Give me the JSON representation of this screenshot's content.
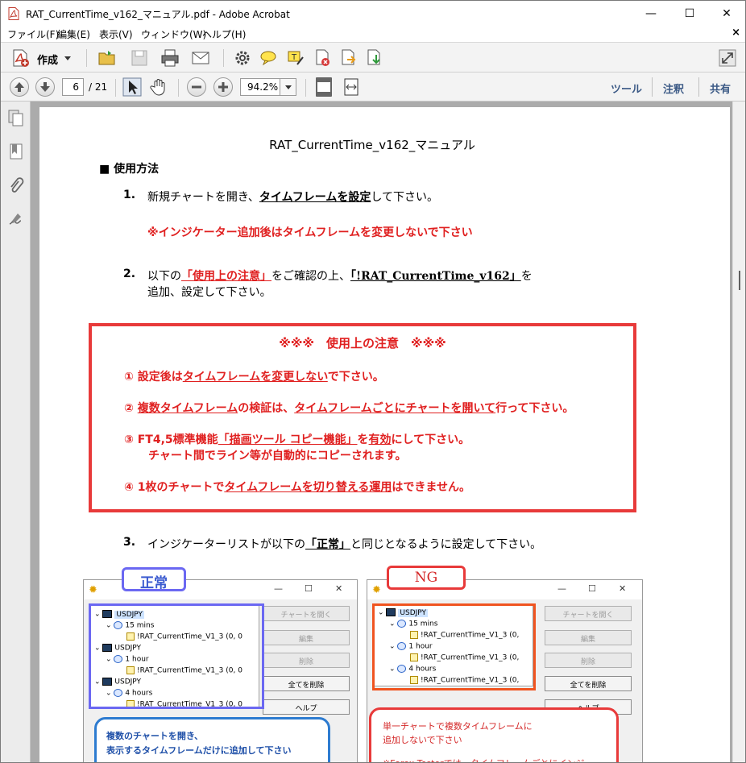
{
  "window": {
    "title": "RAT_CurrentTime_v162_マニュアル.pdf - Adobe Acrobat",
    "minimize": "—",
    "maximize": "☐",
    "close": "✕"
  },
  "menu": {
    "items": [
      "ファイル(F)",
      "編集(E)",
      "表示(V)",
      "ウィンドウ(W)",
      "ヘルプ(H)"
    ],
    "close": "×"
  },
  "toolbar": {
    "create_label": "作成"
  },
  "nav": {
    "page_current": "6",
    "page_total": "/ 21",
    "zoom": "94.2%",
    "tools": "ツール",
    "comment": "注釈",
    "share": "共有"
  },
  "doc": {
    "title": "RAT_CurrentTime_v162_マニュアル",
    "section": "■ 使用方法",
    "step1_num": "1.",
    "step1_a": "新規チャートを開き、",
    "step1_b": "タイムフレームを設定",
    "step1_c": "して下さい。",
    "step1_note": "※インジケーター追加後はタイムフレームを変更しないで下さい",
    "step2_num": "2.",
    "step2_a": "以下の",
    "step2_b": "「使用上の注意」",
    "step2_c": "をご確認の上、",
    "step2_d": "「!RAT_CurrentTime_v162」",
    "step2_e": "を",
    "step2_line2": "追加、設定して下さい。",
    "notice_title": "※※※　使用上の注意　※※※",
    "n1_a": "① 設定後は",
    "n1_b": "タイムフレームを変更しない",
    "n1_c": "で下さい。",
    "n2_a": "② ",
    "n2_b": "複数タイムフレーム",
    "n2_c": "の検証は、",
    "n2_d": "タイムフレームごとにチャートを開いて",
    "n2_e": "行って下さい。",
    "n3_a": "③ FT4,5標準機能",
    "n3_b": "「描画ツール コピー機能」",
    "n3_c": "を",
    "n3_d": "有効",
    "n3_e": "にして下さい。",
    "n3_line2": "チャート間でライン等が自動的にコピーされます。",
    "n4_a": "④ 1枚のチャートで",
    "n4_b": "タイムフレームを切り替える運用",
    "n4_c": "はできません。",
    "step3_num": "3.",
    "step3_a": "インジケーターリストが以下の",
    "step3_b": "「正常」",
    "step3_c": "と同じとなるように設定して下さい。"
  },
  "shot_ok": {
    "label": "正常",
    "rows": [
      {
        "sym": "chart",
        "text": "USDJPY",
        "hl": true
      },
      {
        "sym": "clock",
        "text": "15 mins"
      },
      {
        "sym": "ind",
        "text": "!RAT_CurrentTime_V1_3 (0, 0"
      },
      {
        "sym": "chart",
        "text": "USDJPY"
      },
      {
        "sym": "clock",
        "text": "1 hour"
      },
      {
        "sym": "ind",
        "text": "!RAT_CurrentTime_V1_3 (0, 0"
      },
      {
        "sym": "chart",
        "text": "USDJPY"
      },
      {
        "sym": "clock",
        "text": "4 hours"
      },
      {
        "sym": "ind",
        "text": "!RAT_CurrentTime_V1_3 (0, 0"
      }
    ],
    "buttons": [
      "チャートを開く",
      "編集",
      "削除",
      "全てを削除",
      "ヘルプ"
    ],
    "callout_1": "複数のチャートを開き、",
    "callout_2": "表示するタイムフレームだけに追加して下さい"
  },
  "shot_ng": {
    "label": "NG",
    "rows": [
      {
        "sym": "chart",
        "text": "USDJPY",
        "hl": true
      },
      {
        "sym": "clock",
        "text": "15 mins"
      },
      {
        "sym": "ind",
        "text": "!RAT_CurrentTime_V1_3 (0,"
      },
      {
        "sym": "clock",
        "text": "1 hour"
      },
      {
        "sym": "ind",
        "text": "!RAT_CurrentTime_V1_3 (0,"
      },
      {
        "sym": "clock",
        "text": "4 hours"
      },
      {
        "sym": "ind",
        "text": "!RAT_CurrentTime_V1_3 (0,"
      }
    ],
    "buttons": [
      "チャートを開く",
      "編集",
      "削除",
      "全てを削除",
      "ヘルプ"
    ],
    "callout_1": "単一チャートで複数タイムフレームに",
    "callout_2": "追加しないで下さい",
    "callout_3": "※Forex Testerでは、タイムフレームごとにインジ"
  },
  "colors": {
    "red": "#e02020",
    "notice_border": "#e83a3a",
    "blue": "#6b68f2",
    "orange": "#f05420",
    "link": "#3c5a86"
  }
}
